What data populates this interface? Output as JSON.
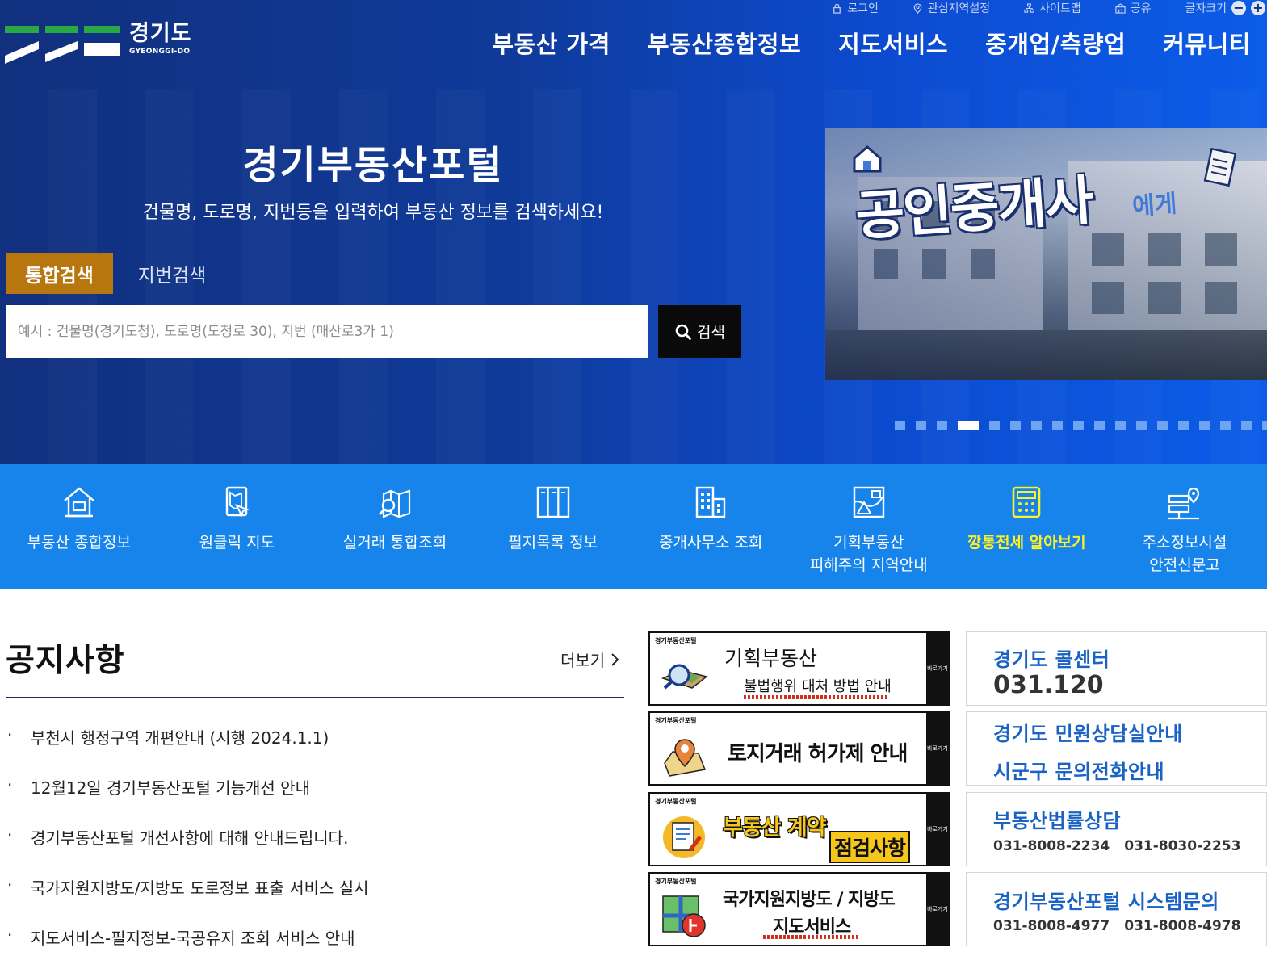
{
  "header": {
    "utility": [
      {
        "label": "로그인",
        "icon": "lock-icon"
      },
      {
        "label": "관심지역설정",
        "icon": "location-pin-icon"
      },
      {
        "label": "사이트맵",
        "icon": "sitemap-icon"
      },
      {
        "label": "공유",
        "icon": "share-icon"
      }
    ],
    "font_size_label": "글자크기",
    "font_decrease": "−",
    "font_increase": "+",
    "logo": {
      "ko": "경기도",
      "en": "GYEONGGI-DO"
    },
    "nav": [
      "부동산 가격",
      "부동산종합정보",
      "지도서비스",
      "중개업/측량업",
      "커뮤니티"
    ]
  },
  "hero": {
    "title": "경기부동산포털",
    "subtitle": "건물명, 도로명, 지번등을 입력하여 부동산 정보를 검색하세요!",
    "tab_active": "통합검색",
    "tab_inactive": "지번검색",
    "search_placeholder": "예시 : 건물명(경기도청), 도로명(도청로 30), 지번 (매산로3가 1)",
    "search_button": "검색",
    "banner_title": "공인중개사",
    "banner_suffix": "에게",
    "slider": {
      "total": 18,
      "active_index": 3
    }
  },
  "quick_menu": [
    {
      "line1": "부동산 종합정보",
      "line2": "",
      "icon": "house-icon",
      "highlight": false
    },
    {
      "line1": "원클릭 지도",
      "line2": "",
      "icon": "map-click-icon",
      "highlight": false
    },
    {
      "line1": "실거래 통합조회",
      "line2": "",
      "icon": "map-search-icon",
      "highlight": false
    },
    {
      "line1": "필지목록 정보",
      "line2": "",
      "icon": "list-columns-icon",
      "highlight": false
    },
    {
      "line1": "중개사무소 조회",
      "line2": "",
      "icon": "building-icon",
      "highlight": false
    },
    {
      "line1": "기획부동산",
      "line2": "피해주의 지역안내",
      "icon": "warning-map-icon",
      "highlight": false
    },
    {
      "line1": "깡통전세 알아보기",
      "line2": "",
      "icon": "calculator-icon",
      "highlight": true
    },
    {
      "line1": "주소정보시설",
      "line2": "안전신문고",
      "icon": "address-sign-icon",
      "highlight": false
    }
  ],
  "notices": {
    "title": "공지사항",
    "more": "더보기",
    "bullet": "·",
    "items": [
      "부천시 행정구역 개편안내 (시행 2024.1.1)",
      "12월12일 경기부동산포털 기능개선 안내",
      "경기부동산포털 개선사항에 대해 안내드립니다.",
      "국가지원지방도/지방도 도로정보 표출 서비스 실시",
      "지도서비스-필지정보-국공유지 조회 서비스 안내"
    ]
  },
  "mid_banners": {
    "tag": "경기부동산포털",
    "side": "바로가기",
    "b1_line1": "기획부동산",
    "b1_line2": "불법행위 대처 방법 안내",
    "b2_text": "토지거래 허가제 안내",
    "b3_text1": "부동산 계약",
    "b3_text2": "점검사항",
    "b4_line1": "국가지원지방도 / 지방도",
    "b4_line2": "지도서비스"
  },
  "info_boxes": {
    "call_title": "경기도 콜센터",
    "call_number": "031.120",
    "civil_title": "경기도 민원상담실안내",
    "city_title": "시군구 문의전화안내",
    "law_title": "부동산법률상담",
    "law_phone1": "031-8008-2234",
    "law_phone2": "031-8030-2253",
    "sys_title": "경기부동산포털 시스템문의",
    "sys_phone1": "031-8008-4977",
    "sys_phone2": "031-8008-4978"
  },
  "colors": {
    "hero_bg": "#11307e",
    "quick_bg": "#1784ec",
    "tab_active": "#b8760e",
    "highlight": "#fff224",
    "info_title": "#1a63c5"
  }
}
